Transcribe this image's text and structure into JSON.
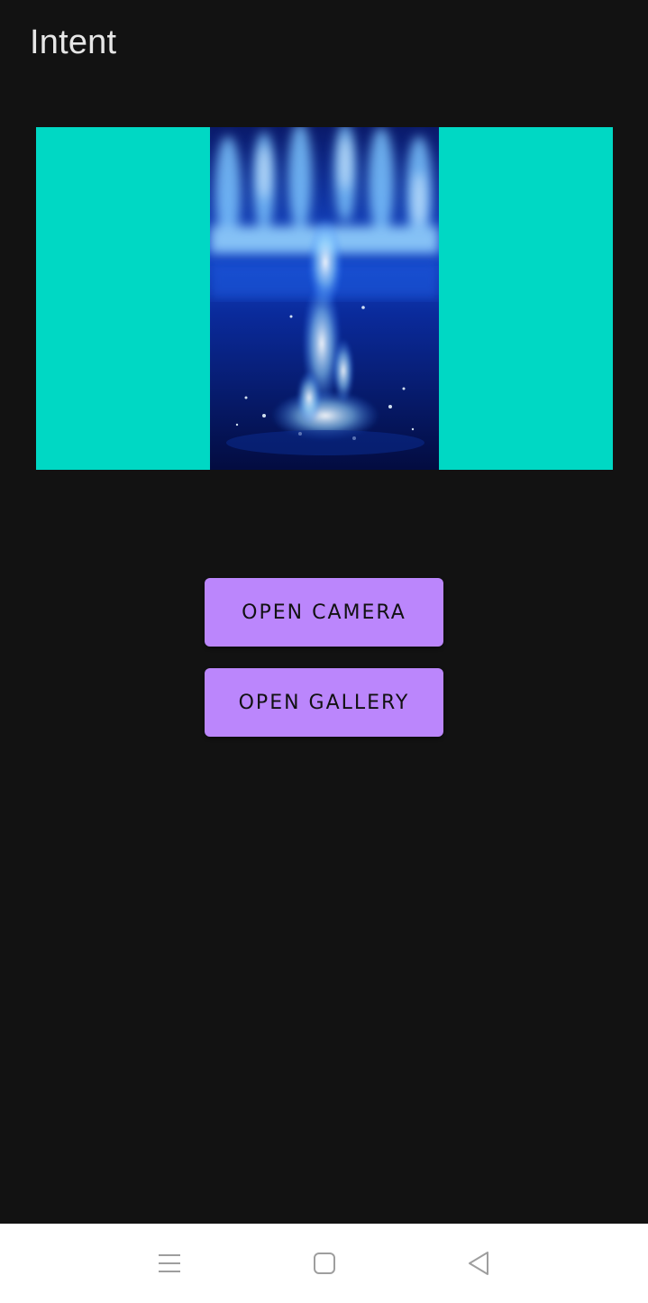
{
  "app_bar": {
    "title": "Intent"
  },
  "image_view": {
    "background_color": "#00d8c4",
    "content": "water-fountain-photo"
  },
  "buttons": {
    "open_camera_label": "OPEN CAMERA",
    "open_gallery_label": "OPEN GALLERY",
    "accent_color": "#bb86fc"
  },
  "nav_bar": {
    "items": [
      {
        "icon": "menu-icon"
      },
      {
        "icon": "home-icon"
      },
      {
        "icon": "back-icon"
      }
    ]
  }
}
